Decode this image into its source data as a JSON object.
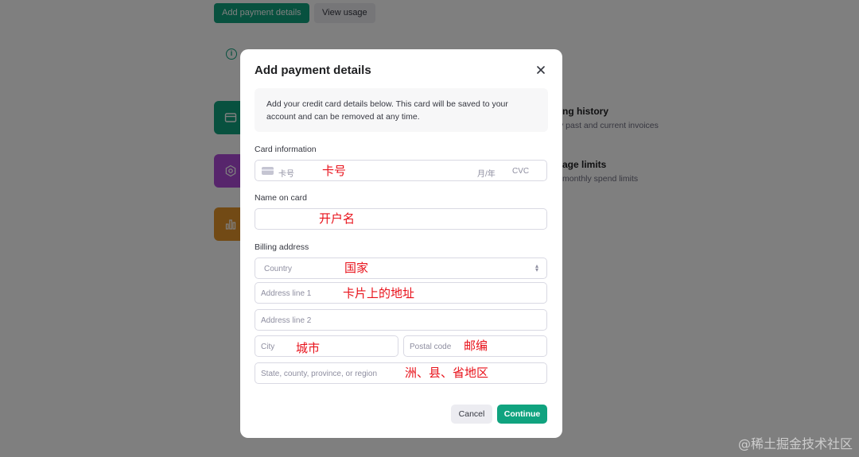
{
  "background": {
    "buttons": {
      "add_payment": "Add payment details",
      "view_usage": "View usage"
    },
    "info_icon": "i",
    "sections": [
      {
        "heading": "ng history",
        "sub": "v past and current invoices"
      },
      {
        "heading": "age limits",
        "sub": "monthly spend limits"
      }
    ]
  },
  "modal": {
    "title": "Add payment details",
    "notice": "Add your credit card details below. This card will be saved to your account and can be removed at any time.",
    "card": {
      "label": "Card information",
      "number_placeholder": "卡号",
      "expiry_placeholder": "月/年",
      "cvc_placeholder": "CVC",
      "annotation": "卡号"
    },
    "name": {
      "label": "Name on card",
      "annotation": "开户名"
    },
    "billing": {
      "label": "Billing address",
      "country_placeholder": "Country",
      "country_annotation": "国家",
      "address1_placeholder": "Address line 1",
      "address1_annotation": "卡片上的地址",
      "address2_placeholder": "Address line 2",
      "city_placeholder": "City",
      "city_annotation": "城市",
      "postal_placeholder": "Postal code",
      "postal_annotation": "邮编",
      "state_placeholder": "State, county, province, or region",
      "state_annotation": "洲、县、省地区"
    },
    "buttons": {
      "cancel": "Cancel",
      "continue": "Continue"
    }
  },
  "watermark": "@稀土掘金技术社区",
  "colors": {
    "accent": "#10a37f",
    "annotation": "#e8121b",
    "tile_purple": "#ae4ad8",
    "tile_orange": "#e4952b"
  },
  "icons": [
    "close-icon",
    "card-icon",
    "settings-icon",
    "chart-icon",
    "info-icon",
    "chevron-updown-icon"
  ]
}
